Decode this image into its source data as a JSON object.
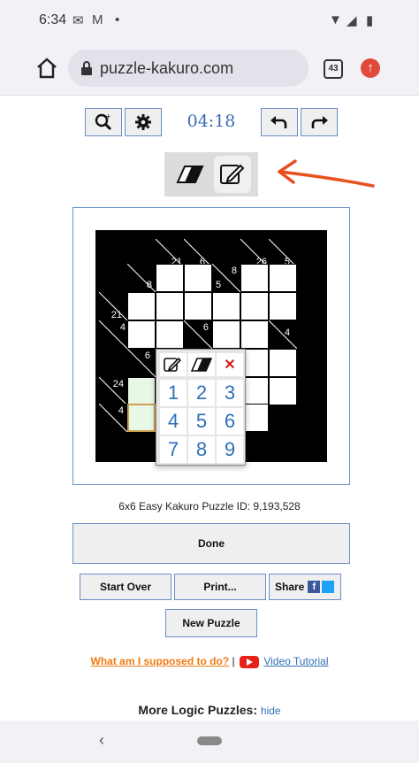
{
  "status": {
    "time": "6:34"
  },
  "browser": {
    "url": "puzzle-kakuro.com",
    "tab_count": "43"
  },
  "toolbar": {
    "timer": "04:18"
  },
  "board": {
    "clues": [
      {
        "id": "c1",
        "right": "21",
        "down": ""
      },
      {
        "id": "c2",
        "right": "6",
        "down": ""
      },
      {
        "id": "c3",
        "right": "26",
        "down": ""
      },
      {
        "id": "c4",
        "right": "5",
        "down": ""
      },
      {
        "id": "c5",
        "right": "8",
        "down": ""
      },
      {
        "id": "c6",
        "right": "8",
        "down": "5"
      },
      {
        "id": "c7",
        "right": "",
        "down": "21"
      },
      {
        "id": "c8",
        "right": "",
        "down": "4"
      },
      {
        "id": "c9",
        "right": "6",
        "down": ""
      },
      {
        "id": "c10",
        "right": "4",
        "down": ""
      },
      {
        "id": "c11",
        "right": "6",
        "down": ""
      },
      {
        "id": "c12",
        "right": "",
        "down": "24"
      },
      {
        "id": "c13",
        "right": "",
        "down": "4"
      }
    ]
  },
  "popup": {
    "keys": [
      "1",
      "2",
      "3",
      "4",
      "5",
      "6",
      "7",
      "8",
      "9"
    ],
    "close_glyph": "✕"
  },
  "puzzle_info": "6x6 Easy Kakuro Puzzle ID: 9,193,528",
  "buttons": {
    "done": "Done",
    "start_over": "Start Over",
    "print": "Print...",
    "share": "Share",
    "new_puzzle": "New Puzzle"
  },
  "links": {
    "help": "What am I supposed to do?",
    "separator": "|",
    "tutorial": "Video Tutorial"
  },
  "more": {
    "title": "More Logic Puzzles:",
    "hide": "hide"
  },
  "colors": {
    "accent": "#2f6fb8",
    "orange": "#f07a14",
    "annotation": "#e8501e"
  }
}
